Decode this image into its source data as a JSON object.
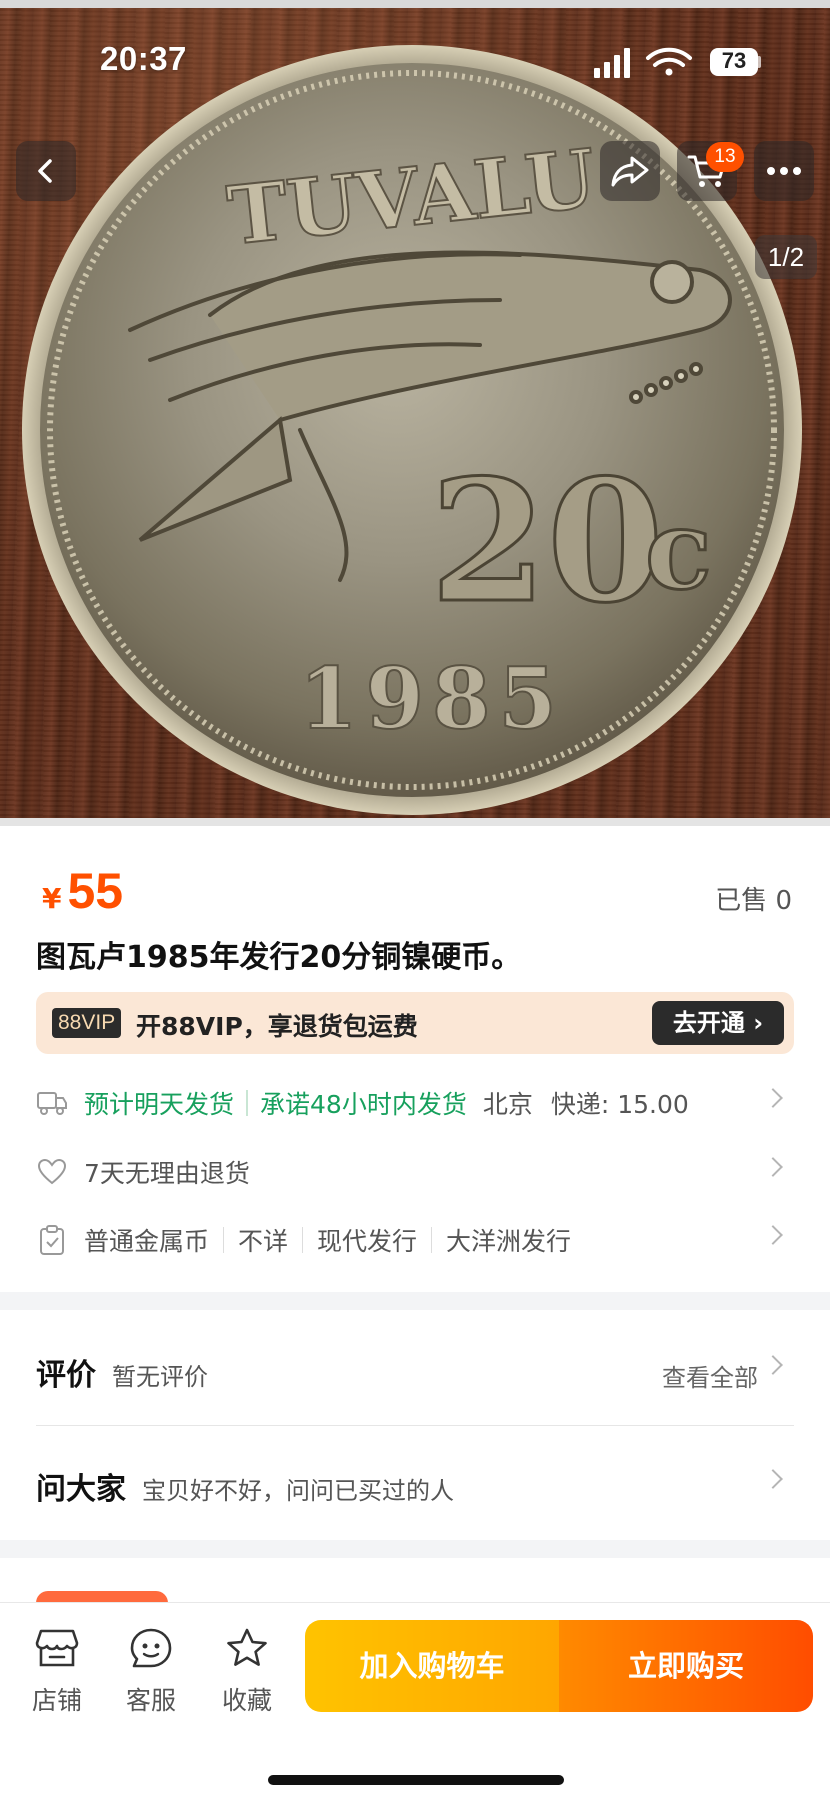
{
  "status_bar": {
    "time": "20:37",
    "battery": "73",
    "icons": [
      "signal-icon",
      "wifi-icon",
      "battery-icon"
    ]
  },
  "hero": {
    "pager": "1/2",
    "cart_badge": "13",
    "coin": {
      "country": "TUVALU",
      "denomination": "20",
      "cents_mark": "c",
      "year": "1985"
    }
  },
  "product": {
    "currency": "¥",
    "price": "55",
    "sold": "已售 0",
    "title": "图瓦卢1985年发行20分铜镍硬币。"
  },
  "vip": {
    "tag": "88VIP",
    "text": "开88VIP，享退货包运费",
    "button": "去开通"
  },
  "shipping": {
    "estimate": "预计明天发货",
    "promise": "承诺48小时内发货",
    "origin": "北京",
    "fee": "快递: 15.00"
  },
  "returns": {
    "text": "7天无理由退货"
  },
  "tags": [
    "普通金属币",
    "不详",
    "现代发行",
    "大洋洲发行"
  ],
  "reviews": {
    "title": "评价",
    "subtitle": "暂无评价",
    "see_all": "查看全部"
  },
  "ask": {
    "title": "问大家",
    "subtitle": "宝贝好不好，问问已买过的人"
  },
  "bottom_bar": {
    "store": "店铺",
    "service": "客服",
    "favorite": "收藏",
    "add_to_cart": "加入购物车",
    "buy_now": "立即购买"
  },
  "colors": {
    "accent": "#ff5000",
    "green": "#17a05d",
    "cart_gradient": [
      "#ffc300",
      "#ffa600"
    ],
    "buy_gradient": [
      "#ff8a00",
      "#ff4d00"
    ]
  }
}
